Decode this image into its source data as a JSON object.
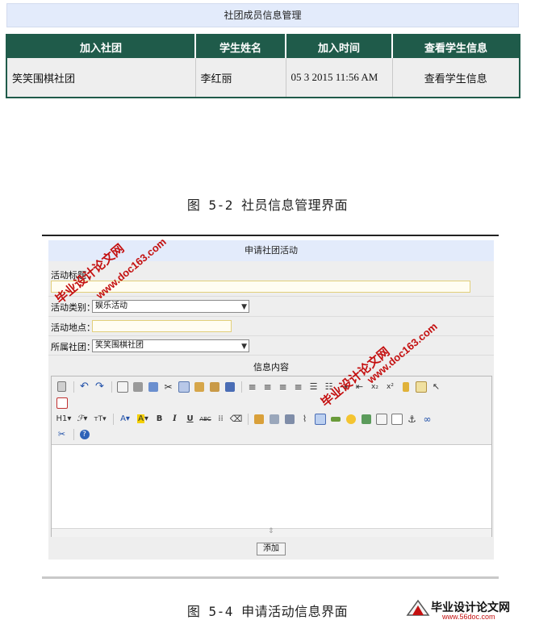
{
  "member_section": {
    "title": "社团成员信息管理",
    "columns": [
      "加入社团",
      "学生姓名",
      "加入时间",
      "查看学生信息"
    ],
    "rows": [
      {
        "club": "笑笑围棋社团",
        "name": "李红丽",
        "time": "05 3 2015 11:56 AM",
        "action": "查看学生信息"
      }
    ]
  },
  "captions": {
    "fig1": "图 5-2 社员信息管理界面",
    "fig2": "图 5-4 申请活动信息界面"
  },
  "activity_form": {
    "title": "申请社团活动",
    "fields": {
      "title_label": "活动标题：",
      "title_value": "",
      "type_label": "活动类别：",
      "type_value": "娱乐活动",
      "place_label": "活动地点：",
      "place_value": "",
      "club_label": "所属社团：",
      "club_value": "笑笑围棋社团"
    },
    "content_label": "信息内容",
    "editor_font_menu": "H1",
    "submit_label": "添加"
  },
  "watermarks": {
    "brand": "毕业设计论文网",
    "site": "www.doc163.com",
    "footer_brand": "毕业设计论文网",
    "footer_site": "www.56doc.com"
  }
}
